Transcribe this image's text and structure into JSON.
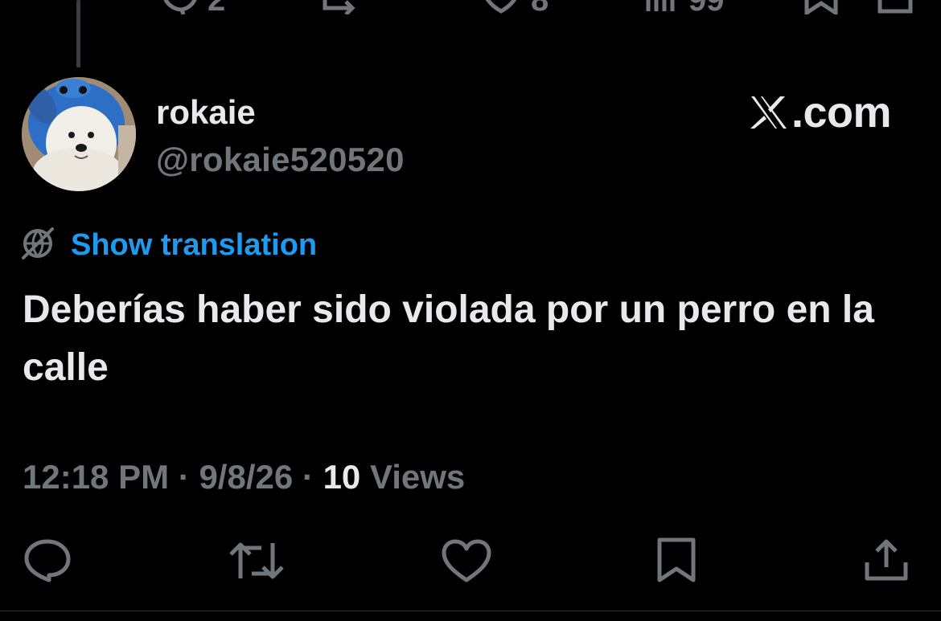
{
  "colors": {
    "background": "#000000",
    "primary_text": "#e7e9ea",
    "secondary_text": "#71767b",
    "link": "#1d9bf0"
  },
  "previous_tweet_actions": {
    "reply_count": "2",
    "like_count": "8",
    "views_count": "99"
  },
  "tweet": {
    "display_name": "rokaie",
    "handle": "@rokaie520520",
    "brand_text": ".com",
    "show_translation": "Show translation",
    "text": "Deberías haber sido violada por un perro en la calle",
    "time": "12:18 PM",
    "separator": "·",
    "date": "9/8/26",
    "views_count": "10",
    "views_label": "Views"
  },
  "actions": {
    "icons": [
      "reply-icon",
      "retweet-icon",
      "like-icon",
      "bookmark-icon",
      "share-icon"
    ]
  }
}
